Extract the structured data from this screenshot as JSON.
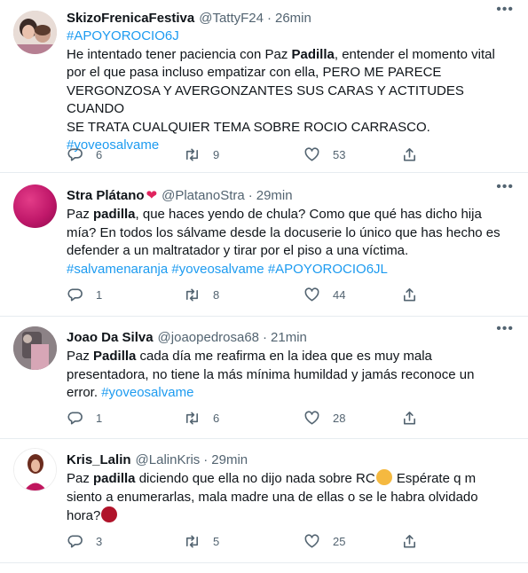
{
  "tweets": [
    {
      "name": "SkizoFrenicaFestiva",
      "handle": "@TattyF24",
      "dot": "·",
      "time": "26min",
      "lines": [
        [
          {
            "t": "#APOYOROCIO6J",
            "k": "tag"
          }
        ],
        [
          {
            "t": "He intentado tener paciencia con Paz "
          },
          {
            "t": "Padilla",
            "k": "b"
          },
          {
            "t": ", entender el momento vital"
          }
        ],
        [
          {
            "t": "por el que pasa incluso empatizar con ella, PERO ME PARECE"
          }
        ],
        [
          {
            "t": "VERGONZOSA Y AVERGONZANTES SUS CARAS Y ACTITUDES CUANDO"
          }
        ],
        [
          {
            "t": "SE TRATA CUALQUIER TEMA SOBRE ROCIO CARRASCO."
          }
        ],
        [
          {
            "t": "#yoveosalvame",
            "k": "tag"
          }
        ]
      ],
      "replies": "6",
      "retweets": "9",
      "likes": "53"
    },
    {
      "name": "Stra Plátano",
      "name_emoji": "❤",
      "handle": "@PlatanoStra",
      "dot": "·",
      "time": "29min",
      "lines": [
        [
          {
            "t": "Paz "
          },
          {
            "t": "padilla",
            "k": "b"
          },
          {
            "t": ", que haces yendo de chula? Como que qué has dicho hija"
          }
        ],
        [
          {
            "t": "mía? En todos los sálvame desde la docuserie lo único que has hecho es"
          }
        ],
        [
          {
            "t": "defender a un maltratador y tirar por el piso a una víctima."
          }
        ],
        [
          {
            "t": "#salvamenaranja",
            "k": "tag"
          },
          {
            "t": " "
          },
          {
            "t": "#yoveosalvame",
            "k": "tag"
          },
          {
            "t": " "
          },
          {
            "t": "#APOYOROCIO6JL",
            "k": "tag"
          }
        ]
      ],
      "replies": "1",
      "retweets": "8",
      "likes": "44"
    },
    {
      "name": "Joao Da Silva",
      "handle": "@joaopedrosa68",
      "dot": "·",
      "time": "21min",
      "lines": [
        [
          {
            "t": "Paz "
          },
          {
            "t": "Padilla",
            "k": "b"
          },
          {
            "t": " cada día me reafirma en la idea que es muy mala"
          }
        ],
        [
          {
            "t": "presentadora, no tiene la más mínima humildad y jamás reconoce un"
          }
        ],
        [
          {
            "t": "error. "
          },
          {
            "t": "#yoveosalvame",
            "k": "tag"
          }
        ]
      ],
      "replies": "1",
      "retweets": "6",
      "likes": "28"
    },
    {
      "name": "Kris_Lalin",
      "handle": "@LalinKris",
      "dot": "·",
      "time": "29min",
      "lines": [
        [
          {
            "t": "Paz "
          },
          {
            "t": "padilla",
            "k": "b"
          },
          {
            "t": " diciendo que ella no dijo nada sobre RC"
          },
          {
            "e": "person-emoji"
          },
          {
            "t": " Espérate q m"
          }
        ],
        [
          {
            "t": "siento a enumerarlas, mala madre una de ellas o se le habra olvidado"
          }
        ],
        [
          {
            "t": "hora?"
          },
          {
            "e": "angry-emoji"
          }
        ]
      ],
      "replies": "3",
      "retweets": "5",
      "likes": "25"
    }
  ],
  "icons": {
    "more": "more-horizontal-icon",
    "reply": "reply-icon",
    "retweet": "retweet-icon",
    "like": "heart-icon",
    "share": "share-icon"
  },
  "colors": {
    "link": "#1d9bf0",
    "text": "#0f1419",
    "secondary": "#536471",
    "divider": "#e6ecf0"
  }
}
